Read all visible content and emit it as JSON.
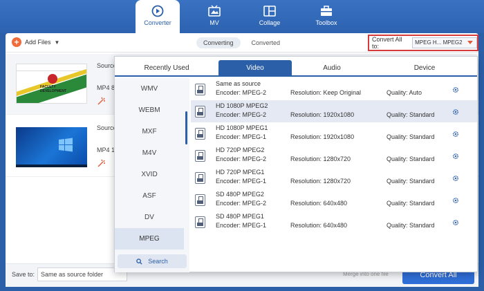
{
  "nav": [
    {
      "label": "Converter",
      "icon": "converter-icon",
      "active": true
    },
    {
      "label": "MV",
      "icon": "mv-icon",
      "active": false
    },
    {
      "label": "Collage",
      "icon": "collage-icon",
      "active": false
    },
    {
      "label": "Toolbox",
      "icon": "toolbox-icon",
      "active": false
    }
  ],
  "toolbar": {
    "add_files": "Add Files",
    "tab_converting": "Converting",
    "tab_converted": "Converted",
    "convert_all_label": "Convert All to:",
    "convert_all_value": "MPEG H... MPEG2"
  },
  "files": [
    {
      "source": "Source",
      "format": "MP4 8",
      "thumb_text": "FACULTY DEVELOPMENT"
    },
    {
      "source": "Source",
      "format": "MP4 1"
    }
  ],
  "bottom": {
    "save_to_label": "Save to:",
    "save_to_value": "Same as source folder",
    "merge_text": "Merge into one file",
    "convert_all_button": "Convert All"
  },
  "panel": {
    "tabs": [
      "Recently Used",
      "Video",
      "Audio",
      "Device"
    ],
    "active_tab": "Video",
    "categories": [
      "WMV",
      "WEBM",
      "MXF",
      "M4V",
      "XVID",
      "ASF",
      "DV",
      "MPEG"
    ],
    "active_category": "MPEG",
    "search_label": "Search",
    "formats": [
      {
        "name": "Same as source",
        "encoder": "Encoder: MPEG-2",
        "resolution": "Resolution: Keep Original",
        "quality": "Quality: Auto",
        "icon_label": "MPEG"
      },
      {
        "name": "HD 1080P MPEG2",
        "encoder": "Encoder: MPEG-2",
        "resolution": "Resolution: 1920x1080",
        "quality": "Quality: Standard",
        "icon_label": "1080P"
      },
      {
        "name": "HD 1080P MPEG1",
        "encoder": "Encoder: MPEG-1",
        "resolution": "Resolution: 1920x1080",
        "quality": "Quality: Standard",
        "icon_label": "1080P"
      },
      {
        "name": "HD 720P MPEG2",
        "encoder": "Encoder: MPEG-2",
        "resolution": "Resolution: 1280x720",
        "quality": "Quality: Standard",
        "icon_label": "720P"
      },
      {
        "name": "HD 720P MPEG1",
        "encoder": "Encoder: MPEG-1",
        "resolution": "Resolution: 1280x720",
        "quality": "Quality: Standard",
        "icon_label": "720P"
      },
      {
        "name": "SD 480P MPEG2",
        "encoder": "Encoder: MPEG-2",
        "resolution": "Resolution: 640x480",
        "quality": "Quality: Standard",
        "icon_label": "480P"
      },
      {
        "name": "SD 480P MPEG1",
        "encoder": "Encoder: MPEG-1",
        "resolution": "Resolution: 640x480",
        "quality": "Quality: Standard",
        "icon_label": "480P"
      }
    ],
    "active_format": "HD 1080P MPEG2"
  },
  "colors": {
    "brand_blue": "#2b5fa8",
    "accent_orange": "#f26b3a",
    "highlight_red": "#d63a3a"
  }
}
